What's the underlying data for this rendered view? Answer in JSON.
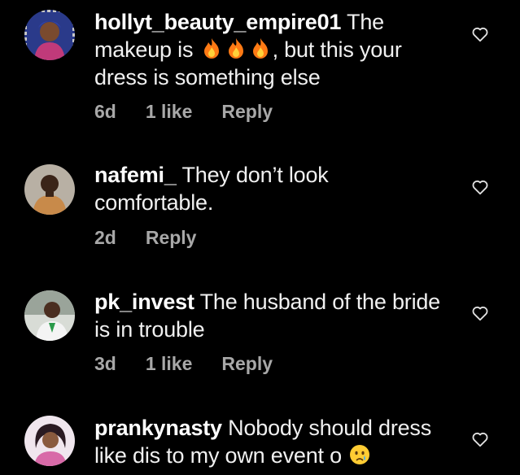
{
  "comments": [
    {
      "username": "hollyt_beauty_empire01",
      "text_pre": " The makeup is ",
      "emojis": [
        "fire-emoji",
        "fire-emoji",
        "fire-emoji"
      ],
      "text_post": ", but this your dress is something else",
      "time": "6d",
      "likes": "1 like",
      "reply": "Reply"
    },
    {
      "username": "nafemi_",
      "text_pre": " They don’t look comfortable.",
      "time": "2d",
      "reply": "Reply"
    },
    {
      "username": "pk_invest",
      "text_pre": " The husband of the bride is in trouble",
      "time": "3d",
      "likes": "1 like",
      "reply": "Reply"
    },
    {
      "username": "prankynasty",
      "text_pre": " Nobody should dress like dis to my own event o ",
      "emojis": [
        "crying-face-emoji"
      ]
    }
  ],
  "icons": {
    "heart": "heart-outline-icon"
  },
  "colors": {
    "background": "#000000",
    "text": "#f0f0f0",
    "meta": "#a8a8a8"
  }
}
